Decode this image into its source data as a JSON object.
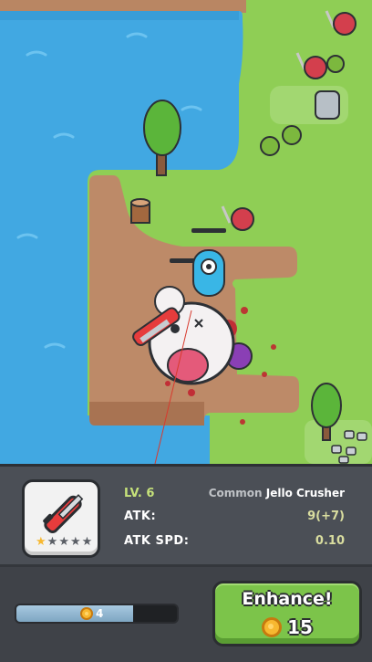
{
  "weapon": {
    "level_label": "LV. 6",
    "rarity": "Common",
    "name": "Jello Crusher",
    "stars_filled": 1,
    "stars_total": 5,
    "icon": "chainsaw-icon"
  },
  "stats": [
    {
      "label": "ATK:",
      "value": "9(+7)"
    },
    {
      "label": "ATK SPD:",
      "value": "0.10"
    }
  ],
  "progress": {
    "coins": "4",
    "fill_fraction": 0.73
  },
  "enhance": {
    "label": "Enhance!",
    "cost": "15"
  },
  "colors": {
    "water": "#41a8e2",
    "grass": "#8fce55",
    "dirt": "#bd8a68",
    "accent_green": "#7cc44a",
    "coin": "#f7b830"
  }
}
